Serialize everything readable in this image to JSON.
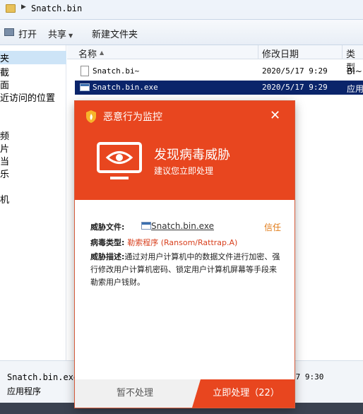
{
  "explorer": {
    "address_path": "Snatch.bin",
    "toolbar": {
      "open": "打开",
      "share": "共享",
      "new_folder": "新建文件夹"
    },
    "nav_items": [
      "夹",
      "截",
      "面",
      "近访问的位置",
      "频",
      "片",
      "当",
      "乐",
      "机"
    ],
    "columns": {
      "name": "名称",
      "date": "修改日期",
      "type": "类型"
    },
    "files": [
      {
        "name": "Snatch.bi~",
        "date": "2020/5/17 9:29",
        "type": "BI~"
      },
      {
        "name": "Snatch.bin.exe",
        "date": "2020/5/17 9:29",
        "type": "应用"
      }
    ],
    "status": {
      "name": "Snatch.bin.exe",
      "type": "应用程序",
      "date": "17 9:30"
    }
  },
  "popup": {
    "title": "恶意行为监控",
    "alert": "发现病毒威胁",
    "advice": "建议您立即处理",
    "threat_file_label": "威胁文件:",
    "threat_file": "Snatch.bin.exe",
    "trust": "信任",
    "virus_type_label": "病毒类型:",
    "virus_type": "勒索程序 (Ransom/Rattrap.A)",
    "desc_label": "威胁描述:",
    "desc": "通过对用户计算机中的数据文件进行加密、强行修改用户计算机密码、锁定用户计算机屏幕等手段来勒索用户钱财。",
    "ignore_btn": "暂不处理",
    "handle_btn": "立即处理（22）",
    "colors": {
      "accent": "#e8461f",
      "trust": "#e07a16"
    }
  }
}
